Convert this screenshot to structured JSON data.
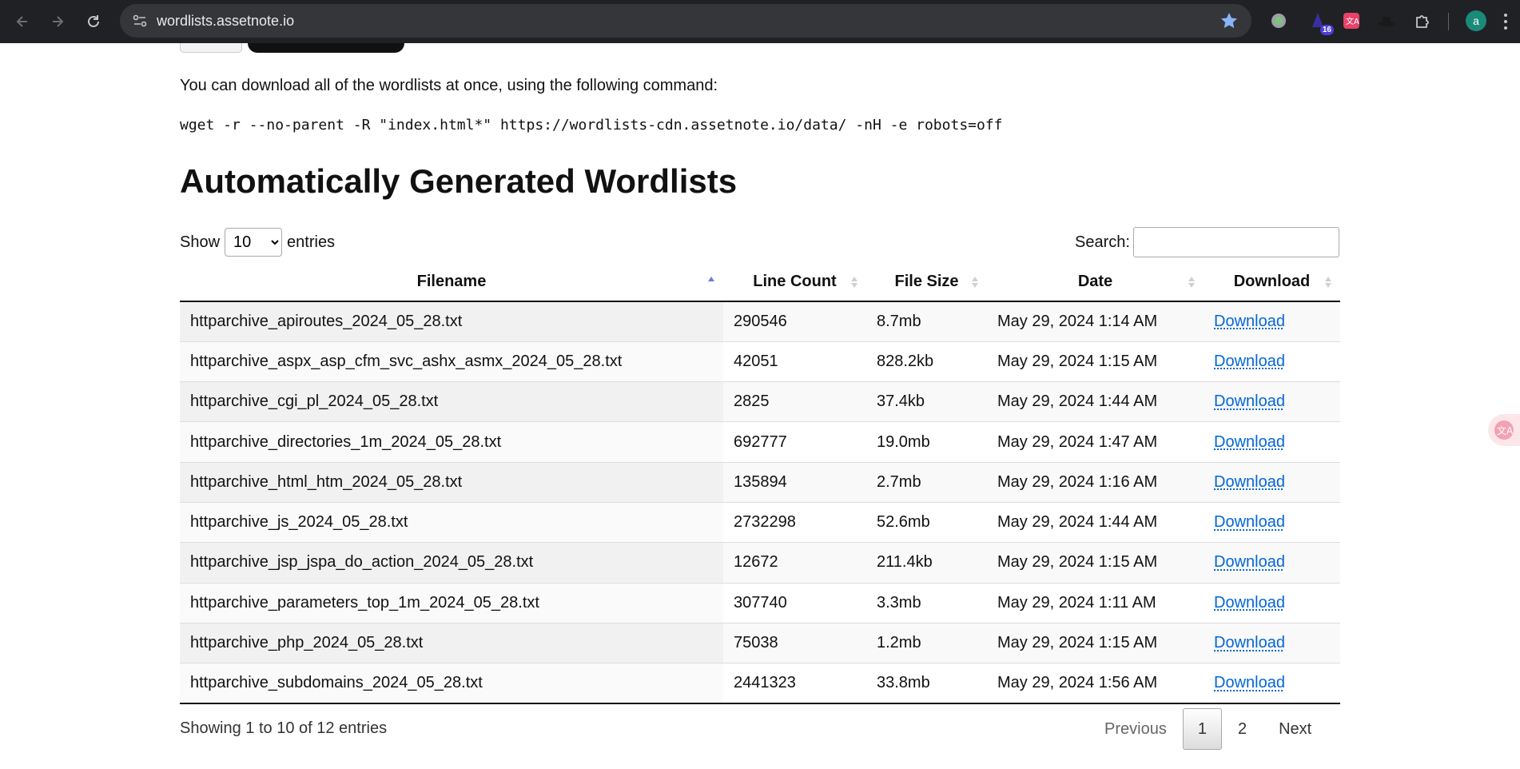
{
  "browser": {
    "url": "wordlists.assetnote.io",
    "profile_initial": "a",
    "extension_badge": "16",
    "accent_color": "#8ab4f8"
  },
  "intro": {
    "text": "You can download all of the wordlists at once, using the following command:",
    "command": "wget -r --no-parent -R \"index.html*\" https://wordlists-cdn.assetnote.io/data/ -nH -e robots=off"
  },
  "section": {
    "title": "Automatically Generated Wordlists"
  },
  "length_control": {
    "prefix": "Show",
    "value": "10",
    "suffix": "entries"
  },
  "search": {
    "label": "Search:",
    "value": ""
  },
  "table": {
    "headers": [
      "Filename",
      "Line Count",
      "File Size",
      "Date",
      "Download"
    ],
    "sorted_column": "Filename",
    "sort_direction": "ascending",
    "rows": [
      {
        "filename": "httparchive_apiroutes_2024_05_28.txt",
        "lines": "290546",
        "size": "8.7mb",
        "date": "May 29, 2024 1:14 AM",
        "link": "Download"
      },
      {
        "filename": "httparchive_aspx_asp_cfm_svc_ashx_asmx_2024_05_28.txt",
        "lines": "42051",
        "size": "828.2kb",
        "date": "May 29, 2024 1:15 AM",
        "link": "Download"
      },
      {
        "filename": "httparchive_cgi_pl_2024_05_28.txt",
        "lines": "2825",
        "size": "37.4kb",
        "date": "May 29, 2024 1:44 AM",
        "link": "Download"
      },
      {
        "filename": "httparchive_directories_1m_2024_05_28.txt",
        "lines": "692777",
        "size": "19.0mb",
        "date": "May 29, 2024 1:47 AM",
        "link": "Download"
      },
      {
        "filename": "httparchive_html_htm_2024_05_28.txt",
        "lines": "135894",
        "size": "2.7mb",
        "date": "May 29, 2024 1:16 AM",
        "link": "Download"
      },
      {
        "filename": "httparchive_js_2024_05_28.txt",
        "lines": "2732298",
        "size": "52.6mb",
        "date": "May 29, 2024 1:44 AM",
        "link": "Download"
      },
      {
        "filename": "httparchive_jsp_jspa_do_action_2024_05_28.txt",
        "lines": "12672",
        "size": "211.4kb",
        "date": "May 29, 2024 1:15 AM",
        "link": "Download"
      },
      {
        "filename": "httparchive_parameters_top_1m_2024_05_28.txt",
        "lines": "307740",
        "size": "3.3mb",
        "date": "May 29, 2024 1:11 AM",
        "link": "Download"
      },
      {
        "filename": "httparchive_php_2024_05_28.txt",
        "lines": "75038",
        "size": "1.2mb",
        "date": "May 29, 2024 1:15 AM",
        "link": "Download"
      },
      {
        "filename": "httparchive_subdomains_2024_05_28.txt",
        "lines": "2441323",
        "size": "33.8mb",
        "date": "May 29, 2024 1:56 AM",
        "link": "Download"
      }
    ]
  },
  "footer": {
    "info": "Showing 1 to 10 of 12 entries",
    "previous": "Previous",
    "pages": [
      "1",
      "2"
    ],
    "current_page": "1",
    "next": "Next"
  }
}
